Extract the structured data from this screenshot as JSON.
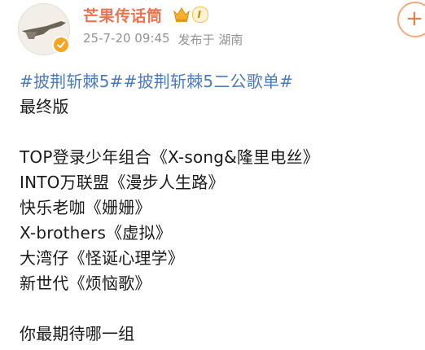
{
  "post": {
    "username": "芒果传话筒",
    "level_badge": "I",
    "timestamp": "25-7-20 09:45",
    "location": "发布于 湖南",
    "follow_label": "+",
    "hashtags": [
      "#披荆斩棘5#",
      "#披荆斩棘5二公歌单#"
    ],
    "lines": {
      "title": "最终版",
      "l1": "TOP登录少年组合《X-song&隆里电丝》",
      "l2": "INTO万联盟《漫步人生路》",
      "l3": "快乐老咖《姗姗》",
      "l4": "X-brothers《虚拟》",
      "l5": "大湾仔《怪诞心理学》",
      "l6": "新世代《烦恼歌》",
      "question": "你最期待哪一组"
    }
  },
  "colors": {
    "username": "#eb7350",
    "hashtag": "#4a7bbd",
    "meta": "#939393",
    "badge": "#f5a623"
  },
  "icons": {
    "avatar": "avatar-image",
    "verified": "verified-icon",
    "crown": "crown-icon",
    "follow": "plus-icon"
  }
}
